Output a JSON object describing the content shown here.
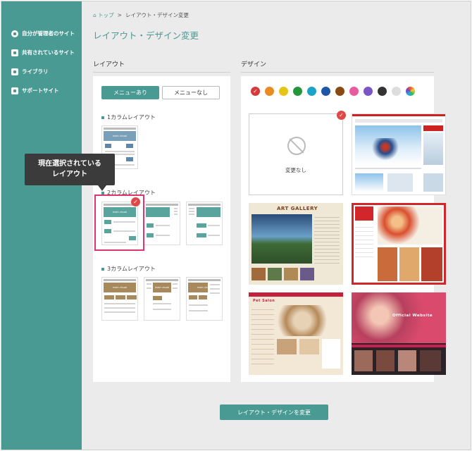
{
  "sidebar": {
    "items": [
      {
        "label": "自分が管理者のサイト",
        "icon": "globe-icon"
      },
      {
        "label": "共有されているサイト",
        "icon": "shared-site-icon"
      },
      {
        "label": "ライブラリ",
        "icon": "library-icon"
      },
      {
        "label": "サポートサイト",
        "icon": "help-icon"
      }
    ]
  },
  "breadcrumb": {
    "home": "トップ",
    "separator": ">",
    "current": "レイアウト・デザイン変更"
  },
  "page_title": "レイアウト・デザイン変更",
  "layout": {
    "heading": "レイアウト",
    "tab_on": "メニューあり",
    "tab_off": "メニューなし",
    "groups": [
      "1カラムレイアウト",
      "2カラムレイアウト",
      "3カラムレイアウト"
    ],
    "thumb_text": "main visual"
  },
  "tooltip": {
    "line1": "現在選択されている",
    "line2": "レイアウト"
  },
  "design": {
    "heading": "デザイン",
    "none_label": "変更なし",
    "card_titles": {
      "gallery": "ART GALLERY",
      "pet": "Pet Salon",
      "official": "Official Website"
    },
    "swatches": [
      "#d63b3b",
      "#e98b22",
      "#e5c616",
      "#27963b",
      "#1ba3c8",
      "#1f56a7",
      "#8a4a14",
      "#e85b9f",
      "#7a55c4",
      "#333333",
      "#dddddd",
      "rainbow"
    ]
  },
  "submit_label": "レイアウト・デザインを変更"
}
